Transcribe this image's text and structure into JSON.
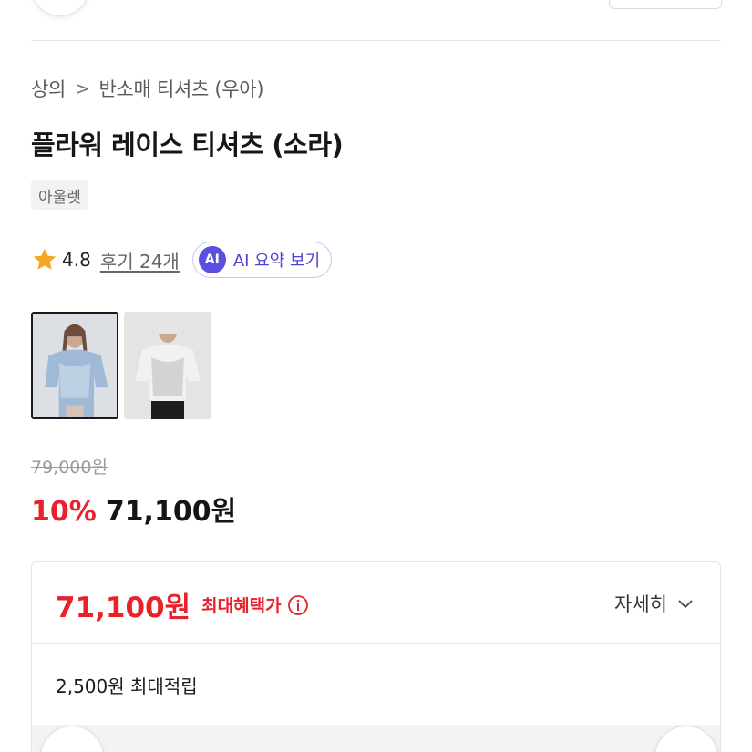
{
  "breadcrumb": {
    "category": "상의",
    "subcategory": "반소매 티셔츠 (우아)"
  },
  "product": {
    "title": "플라워 레이스 티셔츠 (소라)",
    "brand_tag": "아울렛"
  },
  "rating": {
    "score": "4.8",
    "reviews_label": "후기 24개",
    "ai_badge": "AI",
    "ai_summary_label": "AI 요약 보기"
  },
  "thumbnails": [
    {
      "alt": "product-photo-1",
      "selected": true
    },
    {
      "alt": "product-photo-2",
      "selected": false
    }
  ],
  "pricing": {
    "original_price": "79,000원",
    "discount_rate": "10%",
    "sale_price": "71,100원"
  },
  "benefit": {
    "max_price": "71,100원",
    "max_benefit_label": "최대혜택가",
    "details_label": "자세히",
    "points_text": "2,500원 최대적립"
  },
  "colors": {
    "accent_red": "#e8212a",
    "ai_purple": "#5a50e0",
    "star_orange": "#f6a623"
  },
  "icons": [
    "star-icon",
    "ai-icon",
    "info-icon",
    "chevron-down-icon",
    "chevron-right-icon"
  ]
}
